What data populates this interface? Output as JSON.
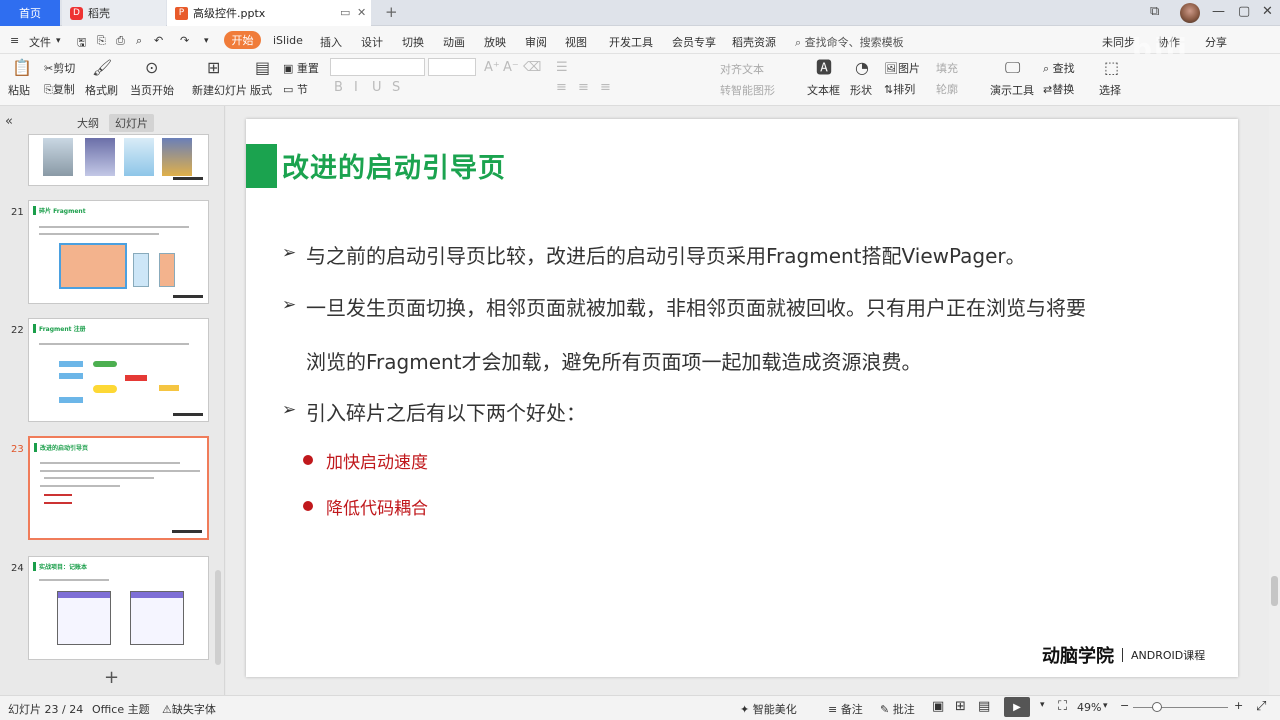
{
  "tabs": {
    "home": "首页",
    "daoke": "稻壳",
    "file": "高级控件.pptx",
    "daoke_icon": "D",
    "file_icon": "P"
  },
  "menubar": {
    "file": "文件",
    "items": [
      "开始",
      "iSlide",
      "插入",
      "设计",
      "切换",
      "动画",
      "放映",
      "审阅",
      "视图",
      "开发工具",
      "会员专享",
      "稻壳资源"
    ],
    "search": "查找命令、搜索模板",
    "right": [
      "未同步",
      "协作",
      "分享"
    ]
  },
  "ribbon": {
    "paste": "粘贴",
    "cut": "剪切",
    "copy": "复制",
    "format_painter": "格式刷",
    "play_current": "当页开始",
    "new_slide": "新建幻灯片",
    "layout": "版式",
    "section": "节",
    "reset": "重置",
    "text_align": "对齐文本",
    "smart_shape": "转智能图形",
    "textbox": "文本框",
    "shape": "形状",
    "picture": "图片",
    "arrange": "排列",
    "fill": "填充",
    "outline": "轮廓",
    "presentation_tools": "演示工具",
    "find": "查找",
    "replace": "替换",
    "select": "选择"
  },
  "left_panel": {
    "tab_outline": "大纲",
    "tab_slides": "幻灯片",
    "thumbs": [
      {
        "num": "21",
        "title": "碎片 Fragment"
      },
      {
        "num": "22",
        "title": "Fragment 注册"
      },
      {
        "num": "23",
        "title": "改进的启动引导页"
      },
      {
        "num": "24",
        "title": "实战项目：记账本"
      }
    ]
  },
  "slide": {
    "title": "改进的启动引导页",
    "bullets": [
      "与之前的启动引导页比较，改进后的启动引导页采用Fragment搭配ViewPager。",
      "一旦发生页面切换，相邻页面就被加载，非相邻页面就被回收。只有用户正在浏览与将要",
      "浏览的Fragment才会加载，避免所有页面项一起加载造成资源浪费。",
      "引入碎片之后有以下两个好处："
    ],
    "sub_bullets": [
      "加快启动速度",
      "降低代码耦合"
    ],
    "brand_logo": "动脑学院",
    "brand_sub": "ANDROID课程"
  },
  "status": {
    "slide_count": "幻灯片 23 / 24",
    "theme": "Office 主题",
    "missing_font": "缺失字体",
    "smart_beautify": "智能美化",
    "notes": "备注",
    "comment": "批注",
    "zoom": "49%"
  },
  "colors": {
    "accent_green": "#1ba34f",
    "accent_red": "#c0181c",
    "tab_blue": "#2f6ef0",
    "active_orange": "#f07c3a"
  }
}
